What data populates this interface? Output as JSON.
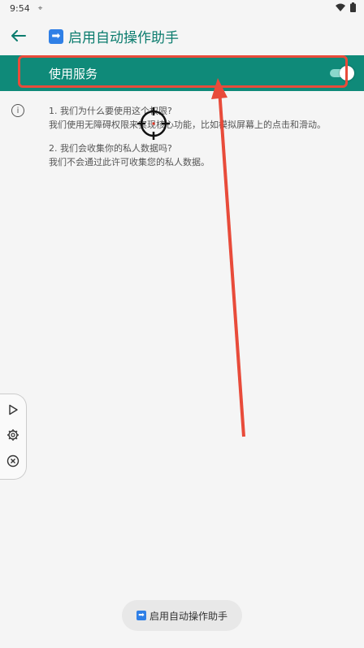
{
  "status_bar": {
    "time": "9:54",
    "indicator": "⌖"
  },
  "app_bar": {
    "title": "启用自动操作助手",
    "title_icon": "➡"
  },
  "service": {
    "label": "使用服务",
    "enabled": true
  },
  "faq": {
    "q1": "1. 我们为什么要使用这个权限?",
    "a1": "我们使用无障碍权限来实现核心功能，比如模拟屏幕上的点击和滑动。",
    "q2": "2. 我们会收集你的私人数据吗?",
    "a2": "我们不会通过此许可收集您的私人数据。"
  },
  "bottom_button": {
    "label": "启用自动操作助手",
    "icon": "➡"
  },
  "colors": {
    "teal": "#0f8a79",
    "title_teal": "#0b7c6e",
    "highlight": "#e84b3a",
    "brand_blue": "#2f7fe6"
  },
  "icons": [
    "back-arrow-icon",
    "info-icon",
    "play-icon",
    "gear-icon",
    "close-icon",
    "wifi-icon",
    "battery-icon",
    "crosshair-icon"
  ]
}
